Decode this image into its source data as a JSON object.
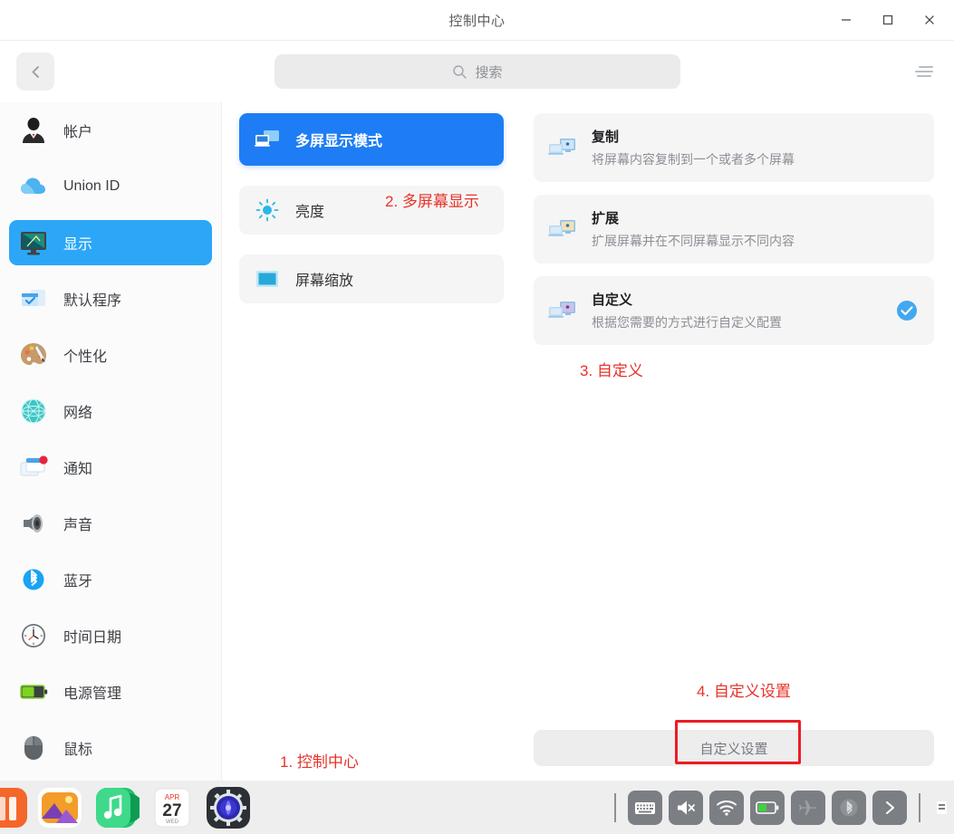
{
  "window": {
    "title": "控制中心",
    "controls": {
      "minimize": "−",
      "maximize": "□",
      "close": "×"
    }
  },
  "toolbar": {
    "back_icon": "chevron-left-icon",
    "search_placeholder": "搜索",
    "menu_icon": "hamburger-icon"
  },
  "sidebar": {
    "items": [
      {
        "label": "帐户",
        "icon": "account-icon",
        "selected": false
      },
      {
        "label": "Union ID",
        "icon": "cloud-icon",
        "selected": false
      },
      {
        "label": "显示",
        "icon": "display-monitor-icon",
        "selected": true
      },
      {
        "label": "默认程序",
        "icon": "default-apps-icon",
        "selected": false
      },
      {
        "label": "个性化",
        "icon": "personalization-palette-icon",
        "selected": false
      },
      {
        "label": "网络",
        "icon": "network-globe-icon",
        "selected": false
      },
      {
        "label": "通知",
        "icon": "notification-icon",
        "selected": false
      },
      {
        "label": "声音",
        "icon": "sound-speaker-icon",
        "selected": false
      },
      {
        "label": "蓝牙",
        "icon": "bluetooth-icon",
        "selected": false
      },
      {
        "label": "时间日期",
        "icon": "clock-icon",
        "selected": false
      },
      {
        "label": "电源管理",
        "icon": "battery-icon",
        "selected": false
      },
      {
        "label": "鼠标",
        "icon": "mouse-icon",
        "selected": false
      }
    ]
  },
  "middle_column": {
    "items": [
      {
        "label": "多屏显示模式",
        "icon": "multi-screen-icon",
        "selected": true
      },
      {
        "label": "亮度",
        "icon": "brightness-sun-icon",
        "selected": false
      },
      {
        "label": "屏幕缩放",
        "icon": "screen-scale-icon",
        "selected": false
      }
    ]
  },
  "right_panel": {
    "options": [
      {
        "title": "复制",
        "desc": "将屏幕内容复制到一个或者多个屏幕",
        "icon": "duplicate-screens-icon",
        "checked": false
      },
      {
        "title": "扩展",
        "desc": "扩展屏幕并在不同屏幕显示不同内容",
        "icon": "extend-screens-icon",
        "checked": false
      },
      {
        "title": "自定义",
        "desc": "根据您需要的方式进行自定义配置",
        "icon": "custom-screens-icon",
        "checked": true
      }
    ],
    "custom_settings_button": "自定义设置"
  },
  "annotations": [
    {
      "text": "1. 控制中心",
      "color": "#e8332a"
    },
    {
      "text": "2. 多屏幕显示",
      "color": "#e8332a"
    },
    {
      "text": "3. 自定义",
      "color": "#e8332a"
    },
    {
      "text": "4. 自定义设置",
      "color": "#e8332a"
    }
  ],
  "dock": {
    "apps": [
      {
        "name": "app-store-icon"
      },
      {
        "name": "photos-icon"
      },
      {
        "name": "music-icon"
      },
      {
        "name": "calendar-icon",
        "month": "APR",
        "day": "27",
        "weekday": "WED"
      },
      {
        "name": "control-center-icon"
      }
    ],
    "tray": [
      {
        "name": "keyboard-icon"
      },
      {
        "name": "speaker-muted-icon"
      },
      {
        "name": "wifi-icon"
      },
      {
        "name": "battery-icon"
      },
      {
        "name": "airplane-mode-icon"
      },
      {
        "name": "bluetooth-icon"
      },
      {
        "name": "expand-chevron-icon"
      }
    ]
  }
}
